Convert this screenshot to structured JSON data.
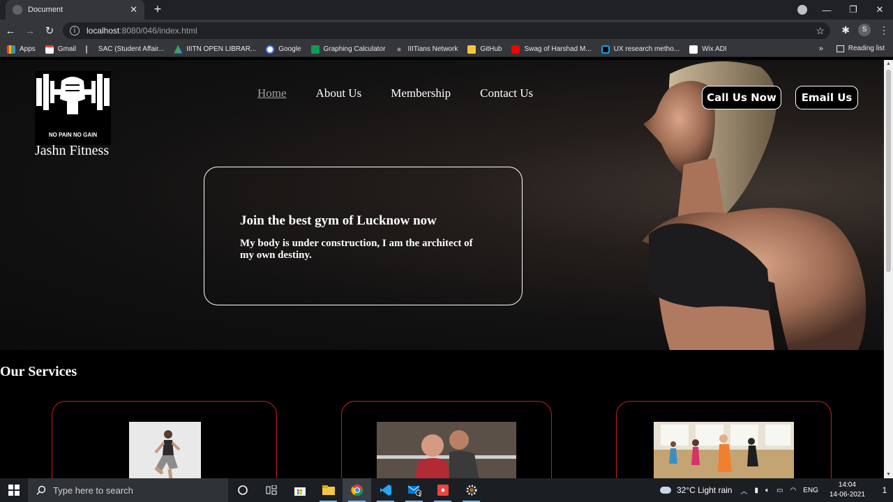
{
  "browser": {
    "tab_title": "Document",
    "url_host": "localhost",
    "url_path": ":8080/046/index.html",
    "profile_initial": "S",
    "bookmarks": [
      "Apps",
      "Gmail",
      "SAC (Student Affair...",
      "IIITN OPEN LIBRAR...",
      "Google",
      "Graphing Calculator",
      "IIITians Network",
      "GitHub",
      "Swag of Harshad M...",
      "UX research metho...",
      "Wix ADI"
    ],
    "more_bookmarks": "»",
    "reading_list": "Reading list"
  },
  "site": {
    "logo_text": "NO PAIN NO GAIN",
    "brand_name": "Jashn Fitness",
    "nav": [
      "Home",
      "About Us",
      "Membership",
      "Contact Us"
    ],
    "call_button": "Call Us Now",
    "email_button": "Email Us",
    "hero_heading": "Join the best gym of Lucknow now",
    "hero_text": "My body is under construction, I am the architect of my own destiny.",
    "services_title": "Our Services"
  },
  "taskbar": {
    "search_placeholder": "Type here to search",
    "weather": "32°C  Light rain",
    "language": "ENG",
    "time": "14:04",
    "date": "14-06-2021",
    "mail_badge": "1",
    "notif_badge": "1"
  }
}
